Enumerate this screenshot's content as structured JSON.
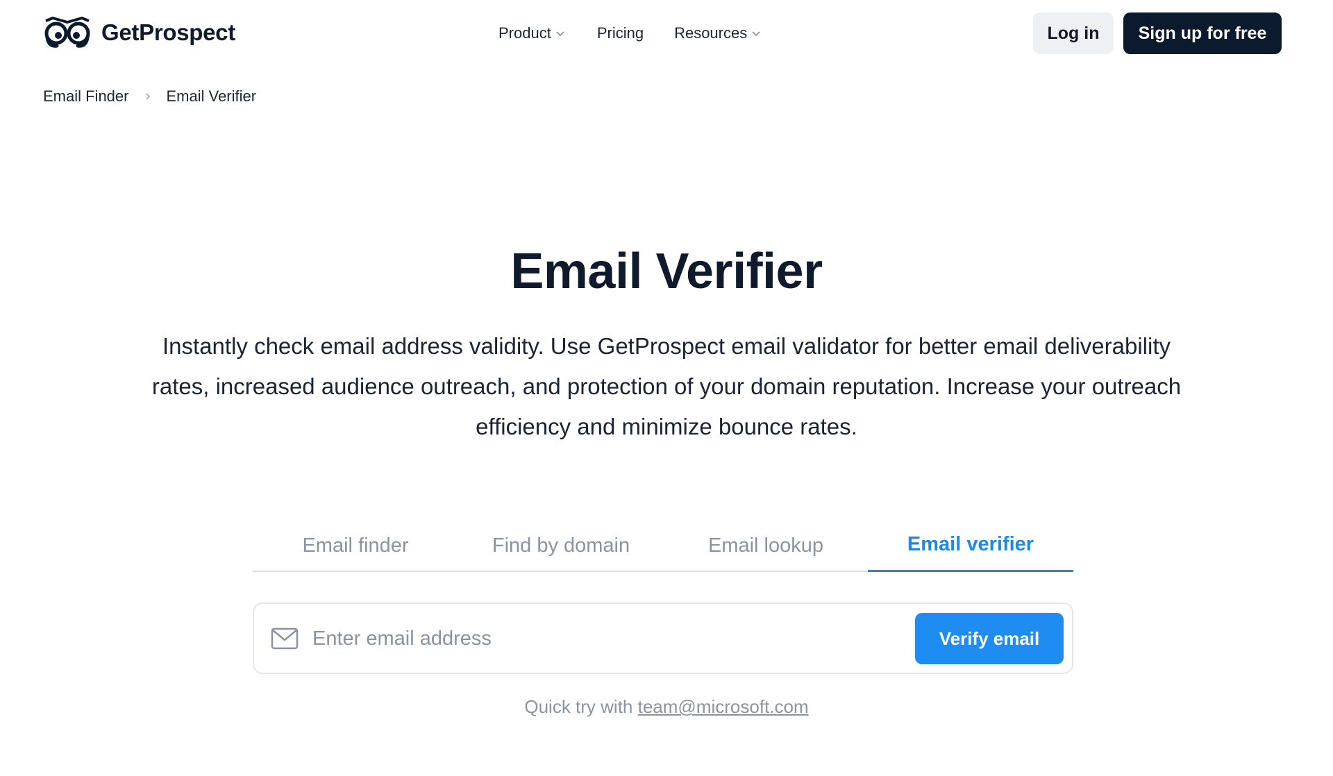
{
  "header": {
    "brand": "GetProspect",
    "nav": [
      {
        "label": "Product",
        "has_dropdown": true
      },
      {
        "label": "Pricing",
        "has_dropdown": false
      },
      {
        "label": "Resources",
        "has_dropdown": true
      }
    ],
    "login_label": "Log in",
    "signup_label": "Sign up for free"
  },
  "breadcrumb": {
    "items": [
      "Email Finder",
      "Email Verifier"
    ]
  },
  "hero": {
    "title": "Email Verifier",
    "description": "Instantly check email address validity. Use GetProspect email validator for better email deliverability rates, increased audience outreach, and protection of your domain reputation. Increase your outreach efficiency and minimize bounce rates."
  },
  "tabs": [
    {
      "label": "Email finder",
      "active": false
    },
    {
      "label": "Find by domain",
      "active": false
    },
    {
      "label": "Email lookup",
      "active": false
    },
    {
      "label": "Email verifier",
      "active": true
    }
  ],
  "search": {
    "placeholder": "Enter email address",
    "value": "",
    "button_label": "Verify email"
  },
  "quick_try": {
    "prefix": "Quick try with",
    "email": "team@microsoft.com"
  },
  "colors": {
    "accent": "#1e8cf0",
    "dark": "#0b1a2c",
    "muted": "#8a939f"
  },
  "icons": [
    "owl-logo-icon",
    "chevron-down-icon",
    "chevron-right-icon",
    "mail-icon"
  ]
}
